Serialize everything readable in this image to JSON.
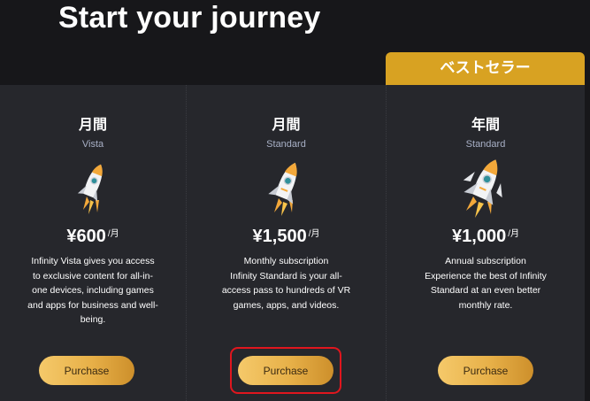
{
  "header": {
    "title": "Start your journey",
    "badge": "ベストセラー"
  },
  "colors": {
    "background": "#17171a",
    "card": "#26272c",
    "badge": "#d8a222",
    "button_gradient_start": "#f5c96a",
    "button_gradient_end": "#cd8f2b",
    "tier_text": "#a8b0c6",
    "highlight": "#e0161e"
  },
  "plans": [
    {
      "period": "月間",
      "tier": "Vista",
      "icon": "rocket-icon",
      "price": "¥600",
      "unit": "/月",
      "description": [
        "Infinity Vista gives you access",
        "to exclusive content for all-in-",
        "one devices, including games",
        "and apps for business and well-",
        "being."
      ],
      "button": "Purchase"
    },
    {
      "period": "月間",
      "tier": "Standard",
      "icon": "rocket-icon",
      "price": "¥1,500",
      "unit": "/月",
      "description": [
        "Monthly subscription",
        "Infinity Standard is your all-",
        "access pass to hundreds of VR",
        "games, apps, and videos."
      ],
      "button": "Purchase"
    },
    {
      "period": "年間",
      "tier": "Standard",
      "icon": "rocket-icon",
      "price": "¥1,000",
      "unit": "/月",
      "description": [
        "Annual subscription",
        "Experience the best of Infinity",
        "Standard at an even better",
        "monthly rate."
      ],
      "button": "Purchase"
    }
  ]
}
